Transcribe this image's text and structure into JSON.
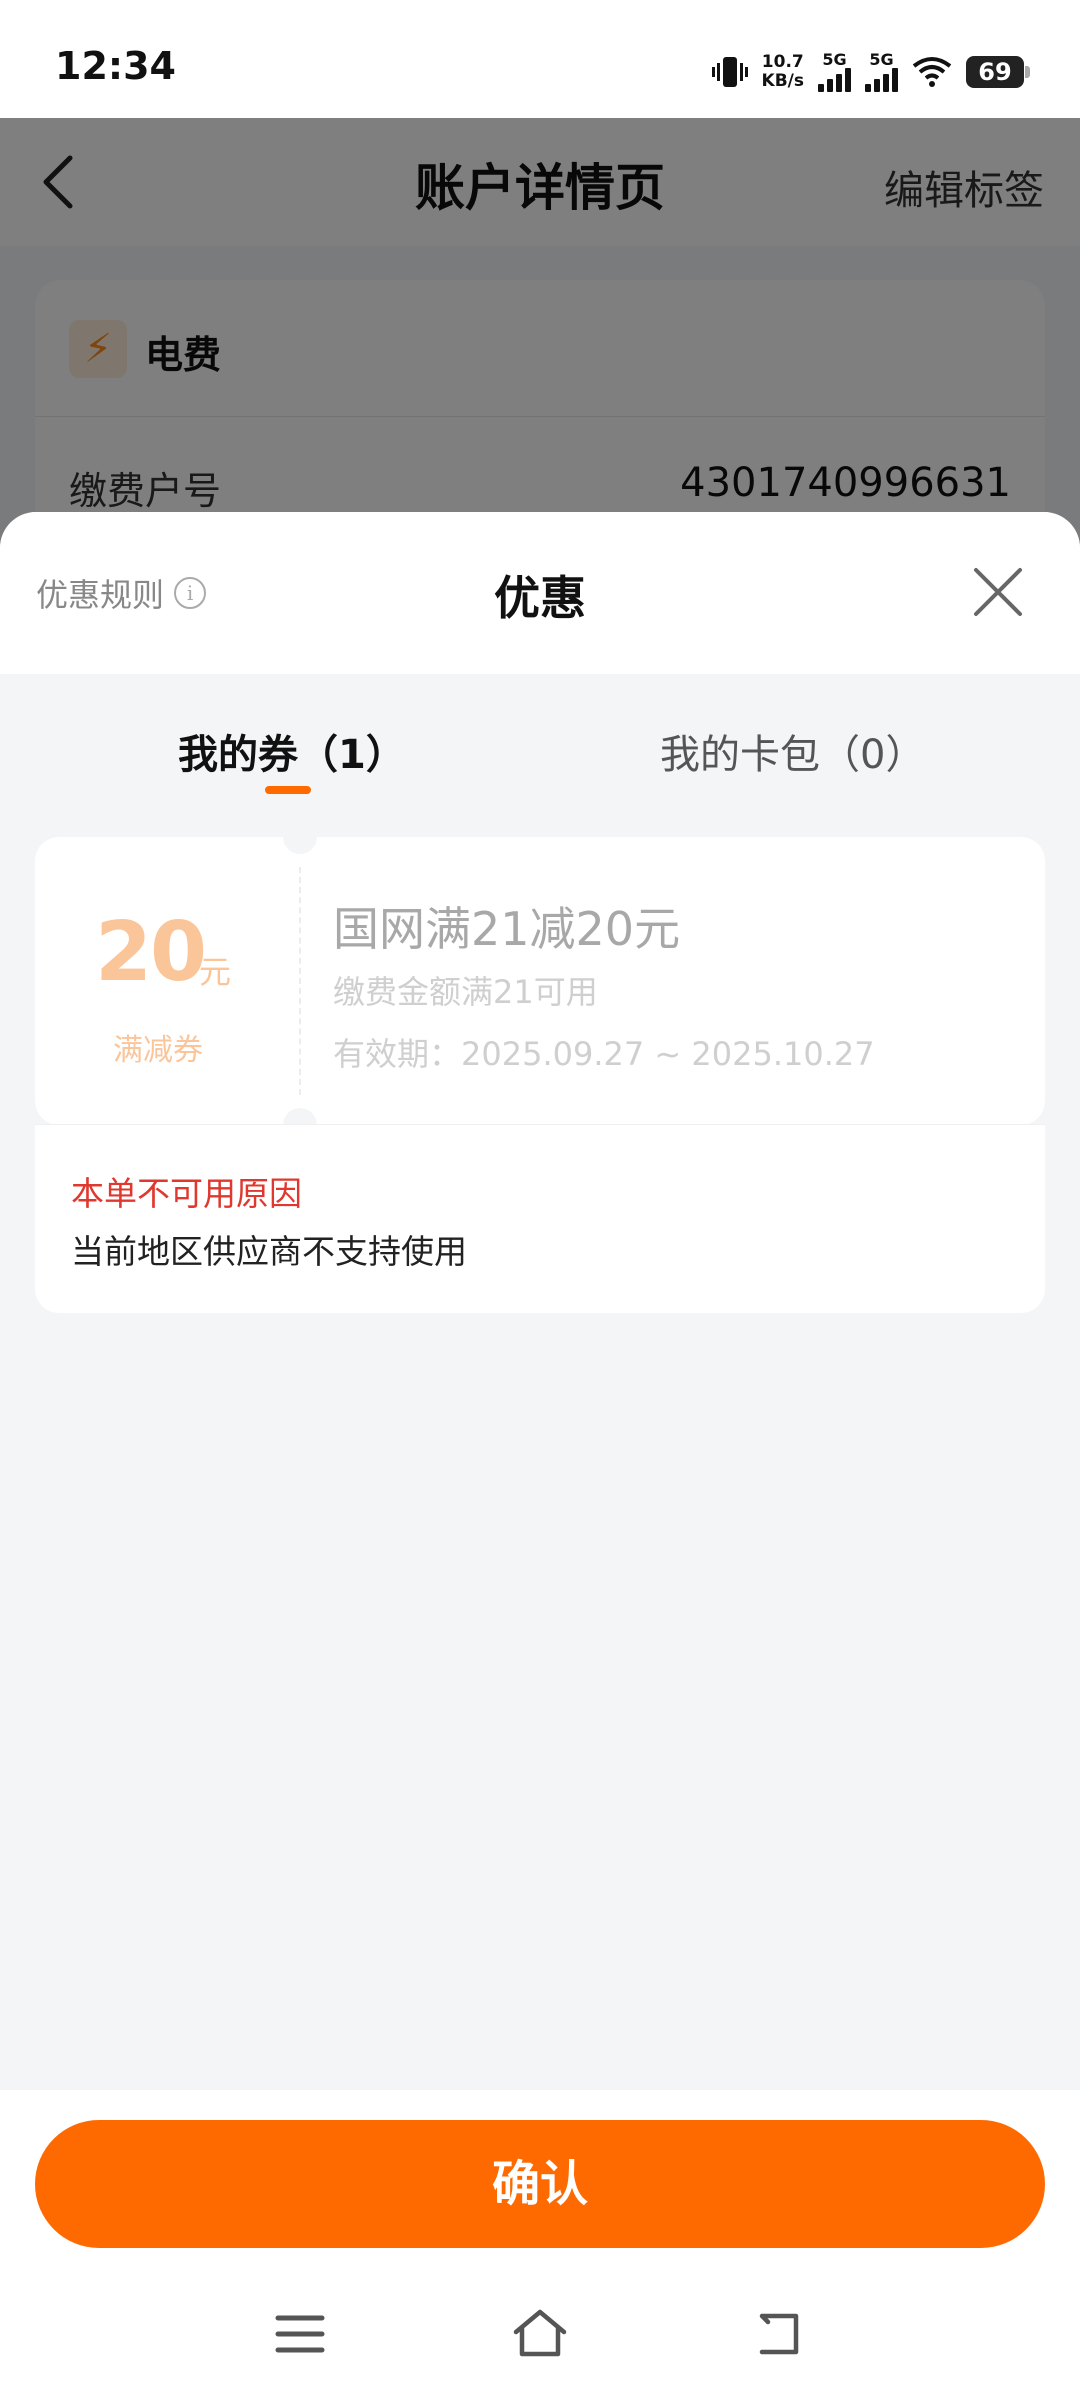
{
  "status_bar": {
    "time": "12:34",
    "net_speed_value": "10.7",
    "net_speed_unit": "KB/s",
    "sim1": "5G",
    "sim2": "5G",
    "battery": "69"
  },
  "background": {
    "title": "账户详情页",
    "edit_label": "编辑标签",
    "bill_type": "电费",
    "account_label": "缴费户号",
    "account_number": "4301740996631",
    "icon": "lightning-icon"
  },
  "sheet": {
    "title": "优惠",
    "rules_label": "优惠规则",
    "close_icon": "close-icon"
  },
  "tabs": {
    "my_coupons": "我的券（1）",
    "my_cards": "我的卡包（0）",
    "active_color": "#ff6a00"
  },
  "coupon": {
    "amount": "20",
    "unit": "元",
    "type": "满减券",
    "name": "国网满21减20元",
    "condition": "缴费金额满21可用",
    "validity": "有效期：2025.09.27 ~ 2025.10.27",
    "amount_color": "#fbc59a"
  },
  "unavailable": {
    "title": "本单不可用原因",
    "reason": "当前地区供应商不支持使用",
    "title_color": "#e0382e"
  },
  "footer": {
    "confirm_label": "确认",
    "button_color": "#ff6a00"
  },
  "nav": [
    "menu-icon",
    "home-icon",
    "back-icon"
  ]
}
